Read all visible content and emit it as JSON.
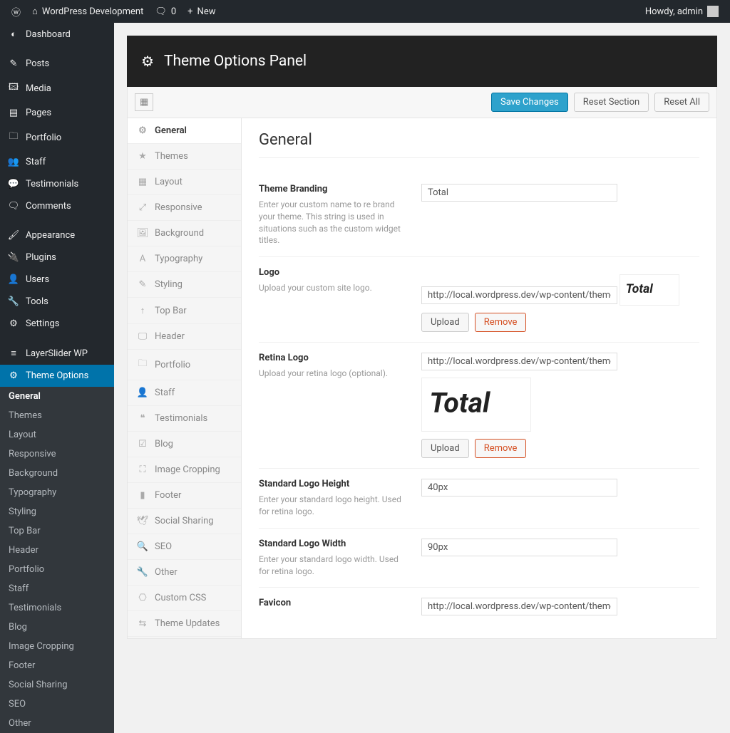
{
  "adminbar": {
    "site": "WordPress Development",
    "comments": "0",
    "new": "New",
    "howdy": "Howdy, admin"
  },
  "wpmenu": [
    {
      "icon": "◐",
      "label": "Dashboard"
    },
    {
      "icon": "✎",
      "label": "Posts",
      "sep": true
    },
    {
      "icon": "🖾",
      "label": "Media"
    },
    {
      "icon": "▤",
      "label": "Pages"
    },
    {
      "icon": "🗀",
      "label": "Portfolio"
    },
    {
      "icon": "👥",
      "label": "Staff"
    },
    {
      "icon": "💬",
      "label": "Testimonials"
    },
    {
      "icon": "🗨",
      "label": "Comments"
    },
    {
      "icon": "🖌",
      "label": "Appearance",
      "sep": true
    },
    {
      "icon": "🔌",
      "label": "Plugins"
    },
    {
      "icon": "👤",
      "label": "Users"
    },
    {
      "icon": "🔧",
      "label": "Tools"
    },
    {
      "icon": "⚙",
      "label": "Settings"
    },
    {
      "icon": "≡",
      "label": "LayerSlider WP",
      "sep": true
    },
    {
      "icon": "⚙",
      "label": "Theme Options",
      "current": true
    }
  ],
  "submenu": [
    {
      "label": "General",
      "on": true
    },
    {
      "label": "Themes"
    },
    {
      "label": "Layout"
    },
    {
      "label": "Responsive"
    },
    {
      "label": "Background"
    },
    {
      "label": "Typography"
    },
    {
      "label": "Styling"
    },
    {
      "label": "Top Bar"
    },
    {
      "label": "Header"
    },
    {
      "label": "Portfolio"
    },
    {
      "label": "Staff"
    },
    {
      "label": "Testimonials"
    },
    {
      "label": "Blog"
    },
    {
      "label": "Image Cropping"
    },
    {
      "label": "Footer"
    },
    {
      "label": "Social Sharing"
    },
    {
      "label": "SEO"
    },
    {
      "label": "Other"
    }
  ],
  "panel": {
    "title": "Theme Options Panel",
    "save": "Save Changes",
    "reset_section": "Reset Section",
    "reset_all": "Reset All"
  },
  "tabs": [
    {
      "icon": "⚙",
      "label": "General",
      "on": true
    },
    {
      "icon": "★",
      "label": "Themes"
    },
    {
      "icon": "▦",
      "label": "Layout"
    },
    {
      "icon": "⤢",
      "label": "Responsive"
    },
    {
      "icon": "🖼",
      "label": "Background"
    },
    {
      "icon": "A",
      "label": "Typography"
    },
    {
      "icon": "✎",
      "label": "Styling"
    },
    {
      "icon": "↑",
      "label": "Top Bar"
    },
    {
      "icon": "🖵",
      "label": "Header"
    },
    {
      "icon": "🗀",
      "label": "Portfolio"
    },
    {
      "icon": "👤",
      "label": "Staff"
    },
    {
      "icon": "❝",
      "label": "Testimonials"
    },
    {
      "icon": "☑",
      "label": "Blog"
    },
    {
      "icon": "⛶",
      "label": "Image Cropping"
    },
    {
      "icon": "▮",
      "label": "Footer"
    },
    {
      "icon": "🕊",
      "label": "Social Sharing"
    },
    {
      "icon": "🔍",
      "label": "SEO"
    },
    {
      "icon": "🔧",
      "label": "Other"
    },
    {
      "icon": "⎔",
      "label": "Custom CSS"
    },
    {
      "icon": "⇆",
      "label": "Theme Updates"
    }
  ],
  "section_title": "General",
  "fields": {
    "branding": {
      "label": "Theme Branding",
      "desc": "Enter your custom name to re brand your theme. This string is used in situations such as the custom widget titles.",
      "value": "Total"
    },
    "logo": {
      "label": "Logo",
      "desc": "Upload your custom site logo.",
      "value": "http://local.wordpress.dev/wp-content/themes/Total/im",
      "upload": "Upload",
      "remove": "Remove"
    },
    "retina": {
      "label": "Retina Logo",
      "desc": "Upload your retina logo (optional).",
      "value": "http://local.wordpress.dev/wp-content/themes/Total/im",
      "upload": "Upload",
      "remove": "Remove"
    },
    "h": {
      "label": "Standard Logo Height",
      "desc": "Enter your standard logo height. Used for retina logo.",
      "value": "40px"
    },
    "w": {
      "label": "Standard Logo Width",
      "desc": "Enter your standard logo width. Used for retina logo.",
      "value": "90px"
    },
    "fav": {
      "label": "Favicon",
      "value": "http://local.wordpress.dev/wp-content/themes/Total/im"
    }
  }
}
